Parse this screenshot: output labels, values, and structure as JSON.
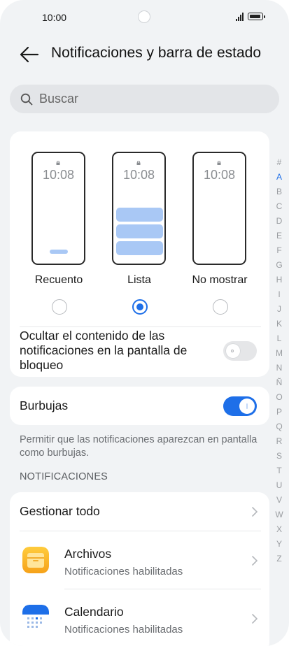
{
  "status_bar": {
    "time": "10:00"
  },
  "header": {
    "title": "Notificaciones y barra de estado"
  },
  "search": {
    "placeholder": "Buscar"
  },
  "lock_styles": {
    "clock": "10:08",
    "options": [
      {
        "label": "Recuento",
        "selected": false
      },
      {
        "label": "Lista",
        "selected": true
      },
      {
        "label": "No mostrar",
        "selected": false
      }
    ]
  },
  "hide_content": {
    "label": "Ocultar el contenido de las notificaciones en la pantalla de bloqueo",
    "enabled": false
  },
  "bubbles": {
    "label": "Burbujas",
    "enabled": true,
    "description": "Permitir que las notificaciones aparezcan en pantalla como burbujas."
  },
  "notifications": {
    "section_title": "NOTIFICACIONES",
    "manage_all": "Gestionar todo",
    "apps": [
      {
        "name": "Archivos",
        "status": "Notificaciones habilitadas",
        "icon": "folder-icon"
      },
      {
        "name": "Calendario",
        "status": "Notificaciones habilitadas",
        "icon": "calendar-icon"
      }
    ]
  },
  "alphabet_index": [
    "#",
    "A",
    "B",
    "C",
    "D",
    "E",
    "F",
    "G",
    "H",
    "I",
    "J",
    "K",
    "L",
    "M",
    "N",
    "Ñ",
    "O",
    "P",
    "Q",
    "R",
    "S",
    "T",
    "U",
    "V",
    "W",
    "X",
    "Y",
    "Z"
  ],
  "colors": {
    "accent": "#1e6fe8",
    "card": "#ffffff",
    "background": "#f1f3f5"
  }
}
